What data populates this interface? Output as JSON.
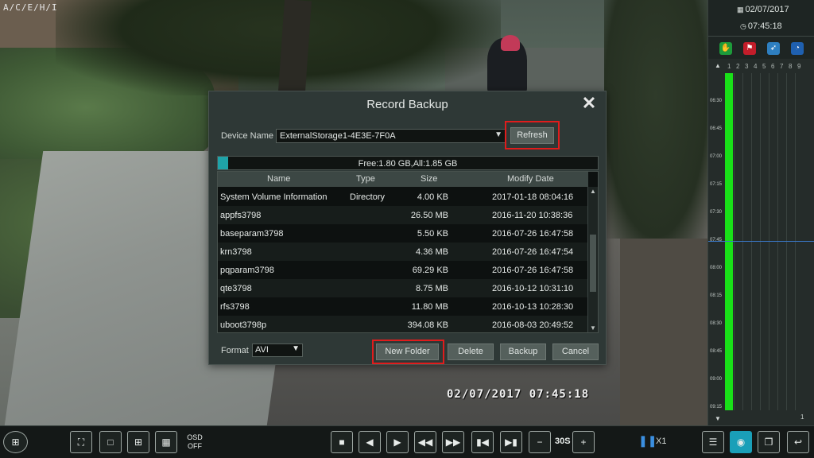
{
  "camera": {
    "label": "A/C/E/H/I",
    "timestamp": "02/07/2017  07:45:18"
  },
  "dialog": {
    "title": "Record Backup",
    "close_icon": "close-icon",
    "device_label": "Device Name",
    "device_value": "ExternalStorage1-4E3E-7F0A",
    "refresh_label": "Refresh",
    "capacity_text": "Free:1.80 GB,All:1.85 GB",
    "capacity_used_fraction": 0.027,
    "columns": {
      "name": "Name",
      "type": "Type",
      "size": "Size",
      "date": "Modify Date"
    },
    "files": [
      {
        "name": "System Volume Information",
        "type": "Directory",
        "size": "4.00 KB",
        "date": "2017-01-18 08:04:16"
      },
      {
        "name": "appfs3798",
        "type": "",
        "size": "26.50 MB",
        "date": "2016-11-20 10:38:36"
      },
      {
        "name": "baseparam3798",
        "type": "",
        "size": "5.50 KB",
        "date": "2016-07-26 16:47:58"
      },
      {
        "name": "krn3798",
        "type": "",
        "size": "4.36 MB",
        "date": "2016-07-26 16:47:54"
      },
      {
        "name": "pqparam3798",
        "type": "",
        "size": "69.29 KB",
        "date": "2016-07-26 16:47:58"
      },
      {
        "name": "qte3798",
        "type": "",
        "size": "8.75 MB",
        "date": "2016-10-12 10:31:10"
      },
      {
        "name": "rfs3798",
        "type": "",
        "size": "11.80 MB",
        "date": "2016-10-13 10:28:30"
      },
      {
        "name": "uboot3798p",
        "type": "",
        "size": "394.08 KB",
        "date": "2016-08-03 20:49:52"
      }
    ],
    "format_label": "Format",
    "format_value": "AVI",
    "buttons": {
      "new_folder": "New Folder",
      "delete": "Delete",
      "backup": "Backup",
      "cancel": "Cancel"
    }
  },
  "panel": {
    "date": "02/07/2017",
    "time": "07:45:18",
    "channels": [
      "1",
      "2",
      "3",
      "4",
      "5",
      "6",
      "7",
      "8",
      "9"
    ],
    "times": [
      "06:30",
      "06:45",
      "07:00",
      "07:15",
      "07:30",
      "07:45",
      "08:00",
      "08:15",
      "08:30",
      "08:45",
      "09:00",
      "09:15"
    ],
    "foot": "1"
  },
  "toolbar": {
    "osd_label": "OSD\nOFF",
    "interval": "30S",
    "speed": "X1"
  }
}
